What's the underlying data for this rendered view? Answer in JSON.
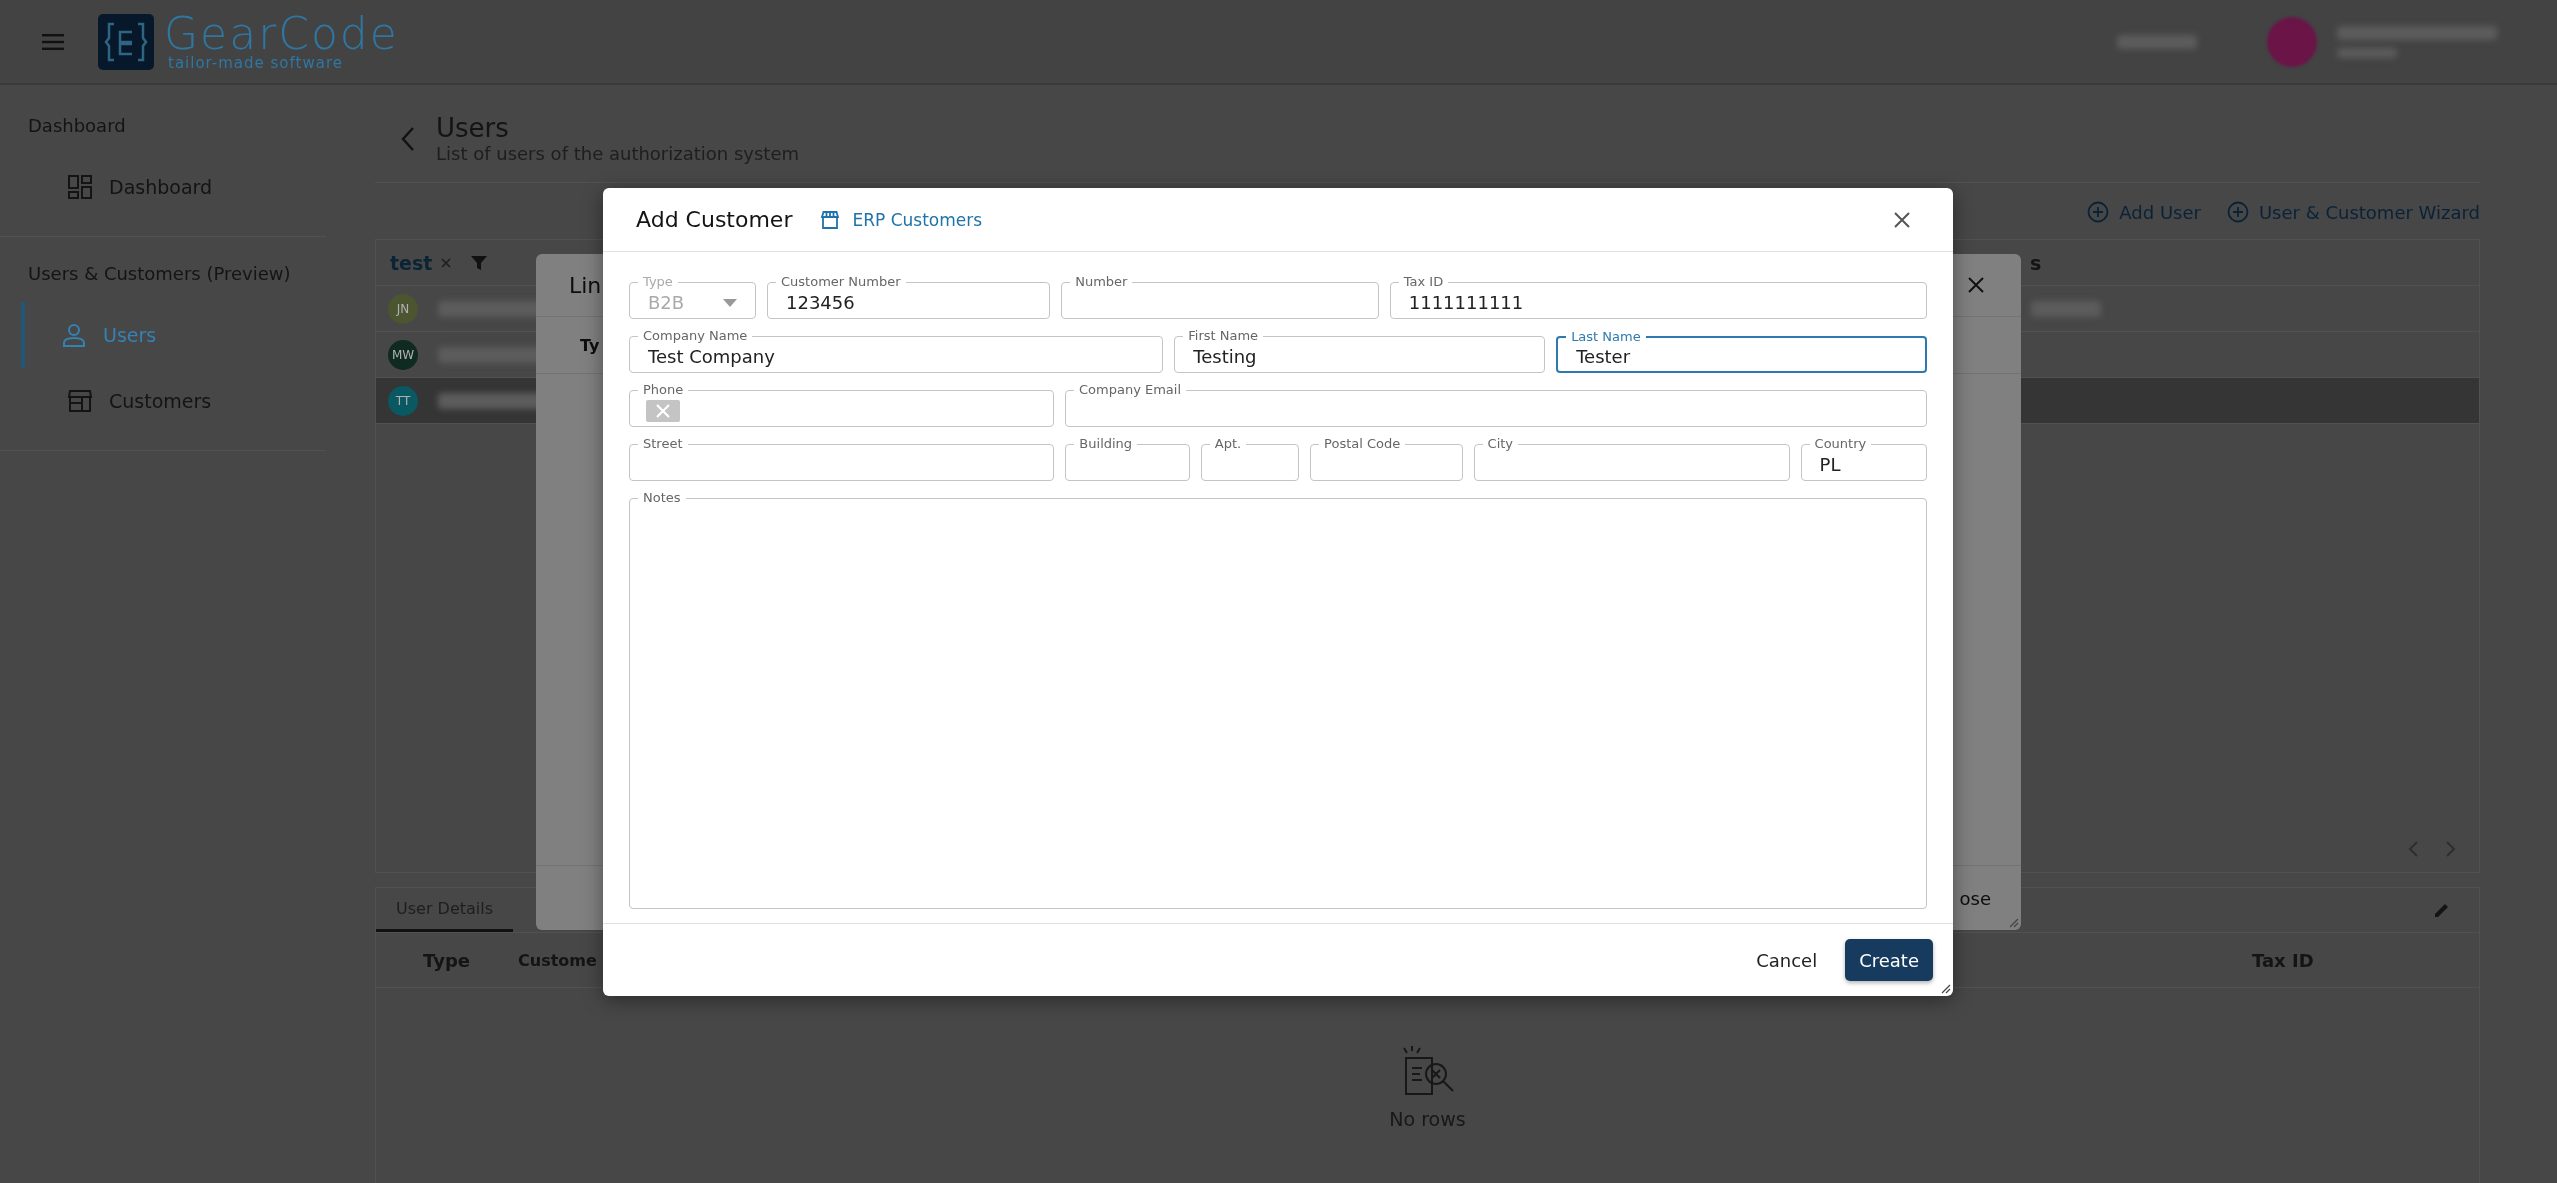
{
  "header": {
    "logo": {
      "name": "GearCode",
      "tagline": "tailor-made software"
    }
  },
  "sidebar": {
    "sections": [
      {
        "title": "Dashboard",
        "items": [
          {
            "label": "Dashboard",
            "selected": false
          }
        ]
      },
      {
        "title": "Users & Customers (Preview)",
        "items": [
          {
            "label": "Users",
            "selected": true
          },
          {
            "label": "Customers",
            "selected": false
          }
        ]
      }
    ]
  },
  "page": {
    "title": "Users",
    "subtitle": "List of users of the authorization system",
    "actions": [
      "Add User",
      "User & Customer Wizard"
    ]
  },
  "users_table": {
    "filter": "test",
    "column_header": "s",
    "rows": [
      {
        "initials": "JN",
        "color": "#4b5530",
        "selected": false
      },
      {
        "initials": "MW",
        "color": "#0f2a20",
        "selected": false
      },
      {
        "initials": "TT",
        "color": "#0a5861",
        "selected": true
      }
    ]
  },
  "details_panel": {
    "tabs": [
      {
        "label": "User Details",
        "selected": true
      }
    ],
    "columns": [
      "Type",
      "Custome",
      "Tax ID"
    ],
    "empty_text": "No rows"
  },
  "link_dialog": {
    "title": "Lin",
    "column": "Ty",
    "button": "ose"
  },
  "add_customer_dialog": {
    "title": "Add Customer",
    "link": "ERP Customers",
    "form_rows": [
      [
        {
          "label": "Type",
          "value": "B2B",
          "kind": "select",
          "focused": false,
          "disabled": true
        },
        {
          "label": "Customer Number",
          "value": "123456",
          "kind": "text",
          "focused": false,
          "disabled": false
        },
        {
          "label": "Number",
          "kind": "text",
          "focused": false,
          "disabled": false
        },
        {
          "label": "Tax ID",
          "value": "1111111111",
          "kind": "text",
          "focused": false,
          "disabled": false
        }
      ],
      [
        {
          "label": "Company Name",
          "value": "Test Company",
          "kind": "text",
          "focused": false,
          "disabled": false
        },
        {
          "label": "First Name",
          "value": "Testing",
          "kind": "text",
          "focused": false,
          "disabled": false
        },
        {
          "label": "Last Name",
          "value": "Tester",
          "kind": "text",
          "focused": true,
          "disabled": false
        }
      ],
      [
        {
          "label": "Phone",
          "kind": "phone",
          "focused": false,
          "disabled": false
        },
        {
          "label": "Company Email",
          "kind": "text",
          "focused": false,
          "disabled": false
        }
      ],
      [
        {
          "label": "Street",
          "kind": "text",
          "focused": false,
          "disabled": false
        },
        {
          "label": "Building",
          "kind": "text",
          "focused": false,
          "disabled": false
        },
        {
          "label": "Apt.",
          "kind": "text",
          "focused": false,
          "disabled": false
        },
        {
          "label": "Postal Code",
          "kind": "text",
          "focused": false,
          "disabled": false
        },
        {
          "label": "City",
          "kind": "text",
          "focused": false,
          "disabled": false
        },
        {
          "label": "Country",
          "value": "PL",
          "kind": "text",
          "focused": false,
          "disabled": false
        }
      ],
      [
        {
          "label": "Notes",
          "kind": "textarea",
          "focused": false,
          "disabled": false
        }
      ]
    ],
    "buttons": [
      {
        "label": "Cancel",
        "kind": "text"
      },
      {
        "label": "Create",
        "kind": "primary"
      }
    ]
  }
}
